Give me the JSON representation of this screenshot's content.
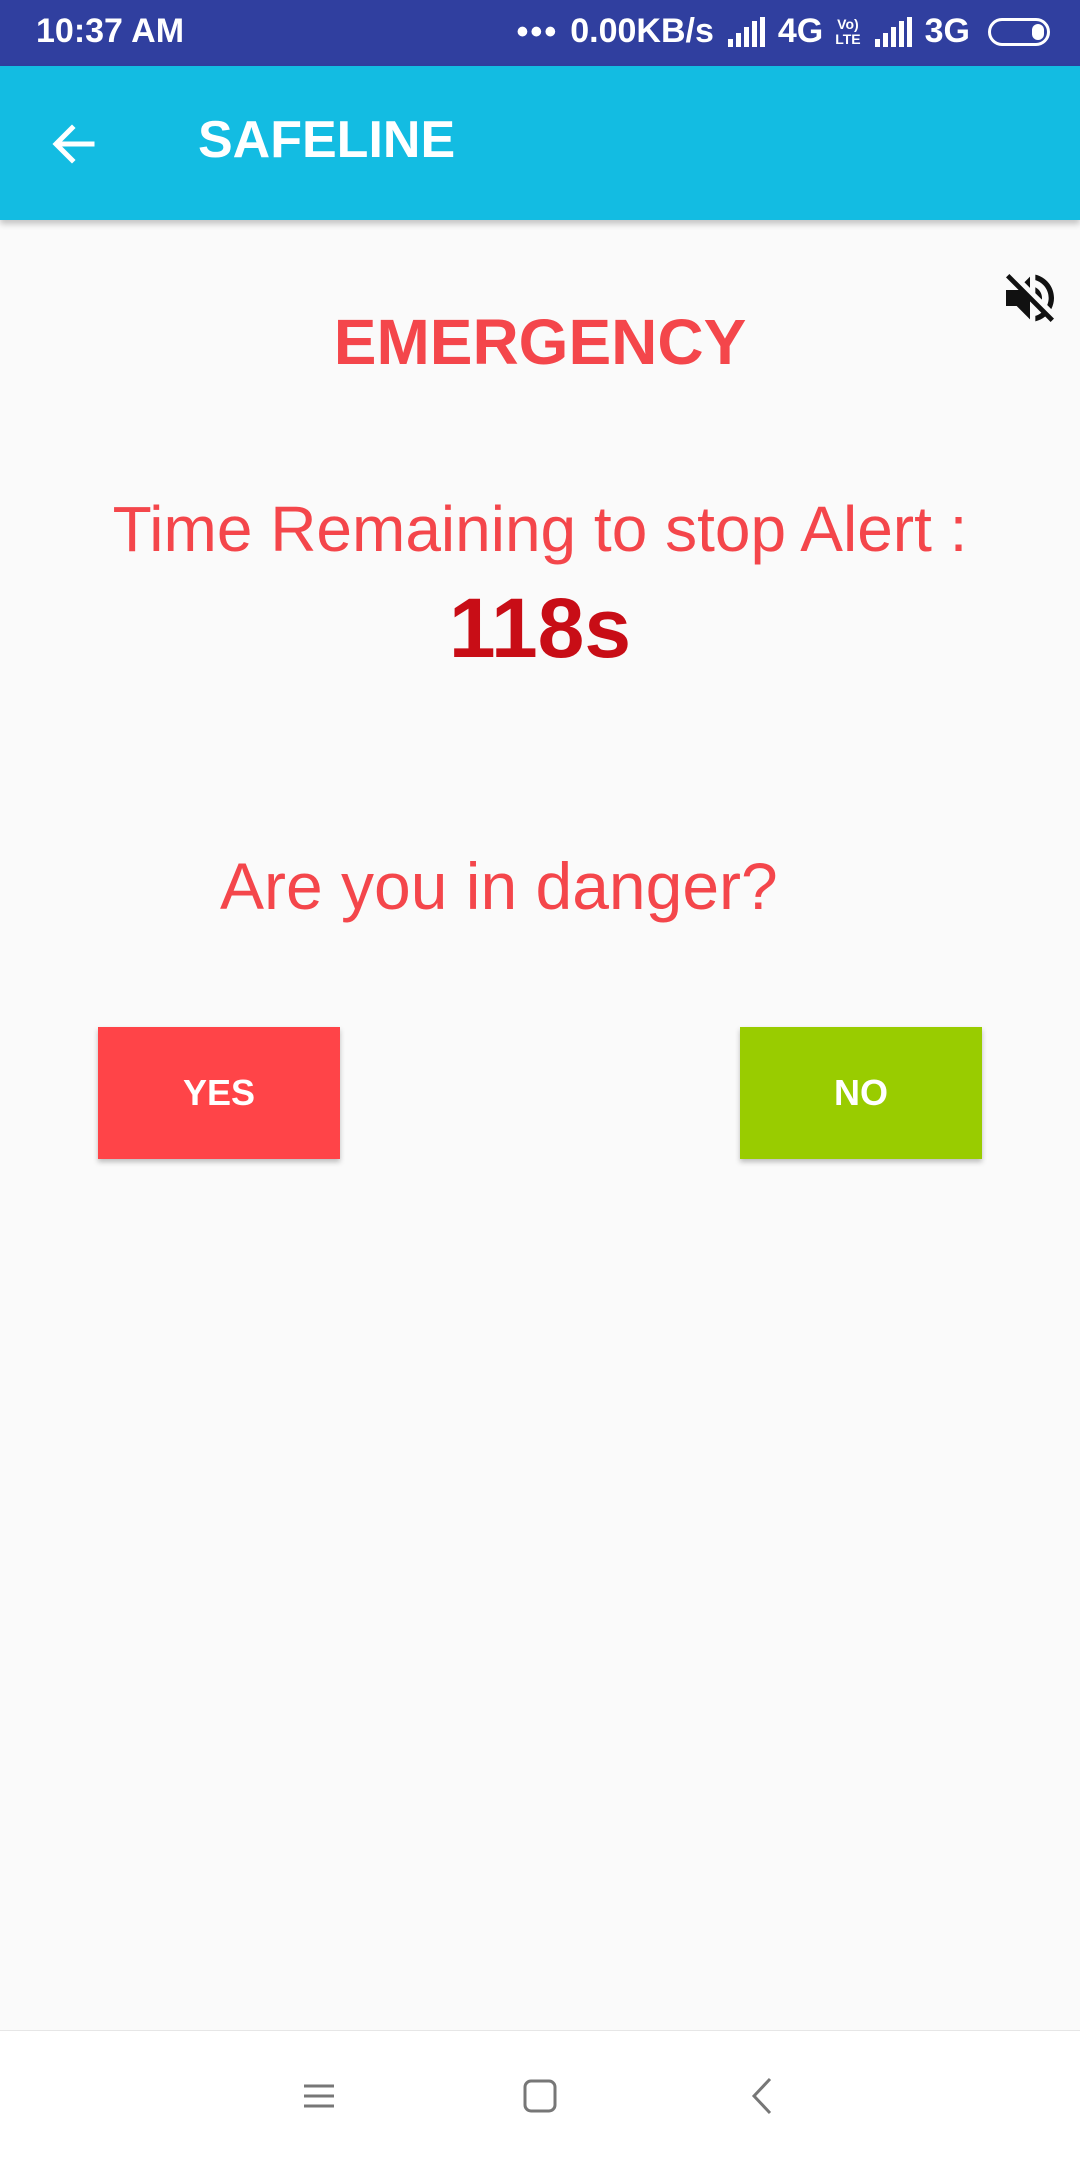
{
  "status_bar": {
    "time": "10:37 AM",
    "net_speed": "0.00KB/s",
    "network_1": "4G",
    "volte_top": "Vo)",
    "volte_bottom": "LTE",
    "network_2": "3G"
  },
  "app_bar": {
    "title": "SAFELINE",
    "back_icon": "arrow-left-icon"
  },
  "alert": {
    "heading": "EMERGENCY",
    "timer_label": "Time Remaining to stop Alert :",
    "timer_value": "118s",
    "question": "Are you in danger?",
    "mute_icon": "volume-off-icon"
  },
  "actions": {
    "yes_label": "YES",
    "no_label": "NO"
  },
  "colors": {
    "status_bar": "#303f9f",
    "app_bar": "#13bce2",
    "alert_text": "#f4464b",
    "timer_text": "#c80d16",
    "yes_button": "#ff4448",
    "no_button": "#99cc00"
  },
  "nav_bar": {
    "icons": [
      "menu-icon",
      "home-square-icon",
      "back-chevron-icon"
    ]
  }
}
